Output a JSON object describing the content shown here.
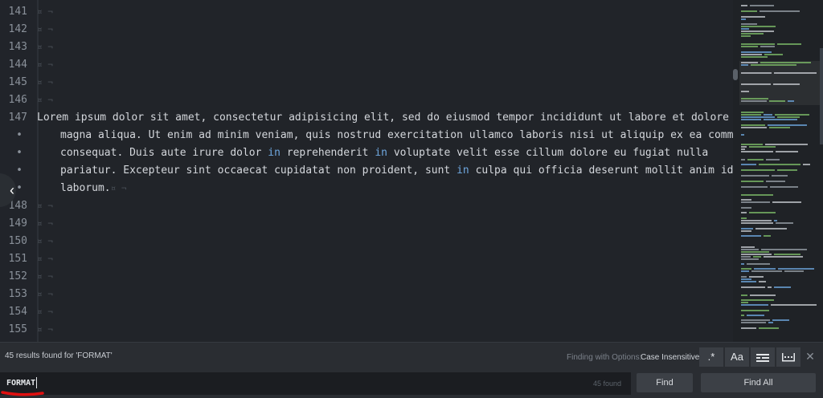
{
  "editor": {
    "lines_before": [
      "141",
      "142",
      "143",
      "144",
      "145",
      "146"
    ],
    "line_147": {
      "number": "147",
      "wrap_markers": [
        "•",
        "•",
        "•",
        "•"
      ],
      "segments": [
        "Lorem ipsum dolor sit amet, consectetur adipisicing elit, sed do eiusmod tempor incididunt ut labore et dolore",
        "magna aliqua. Ut enim ad minim veniam, quis nostrud exercitation ullamco laboris nisi ut aliquip ex ea commodo",
        "consequat. Duis aute irure dolor ",
        "in",
        " reprehenderit ",
        "in",
        " voluptate velit esse cillum dolore eu fugiat nulla",
        "pariatur. Excepteur sint occaecat cupidatat non proident, sunt ",
        "in",
        " culpa qui officia deserunt mollit anim id est",
        "laborum."
      ]
    },
    "lines_after": [
      "148",
      "149",
      "150",
      "151",
      "152",
      "153",
      "154",
      "155"
    ],
    "whitespace_marker": "¤ ¬"
  },
  "find_panel": {
    "status": "45 results found for 'FORMAT'",
    "options_label": "Finding with Options:",
    "options_value": "Case Insensitive",
    "regex_label": ".*",
    "case_label": "Aa",
    "close_label": "✕",
    "query": "FORMAT",
    "found_count": "45 found",
    "find_label": "Find",
    "find_all_label": "Find All",
    "arrow_label": "‹"
  },
  "colors": {
    "background": "#212429",
    "keyword": "#6fa8e0",
    "annotation": "#e01010"
  }
}
